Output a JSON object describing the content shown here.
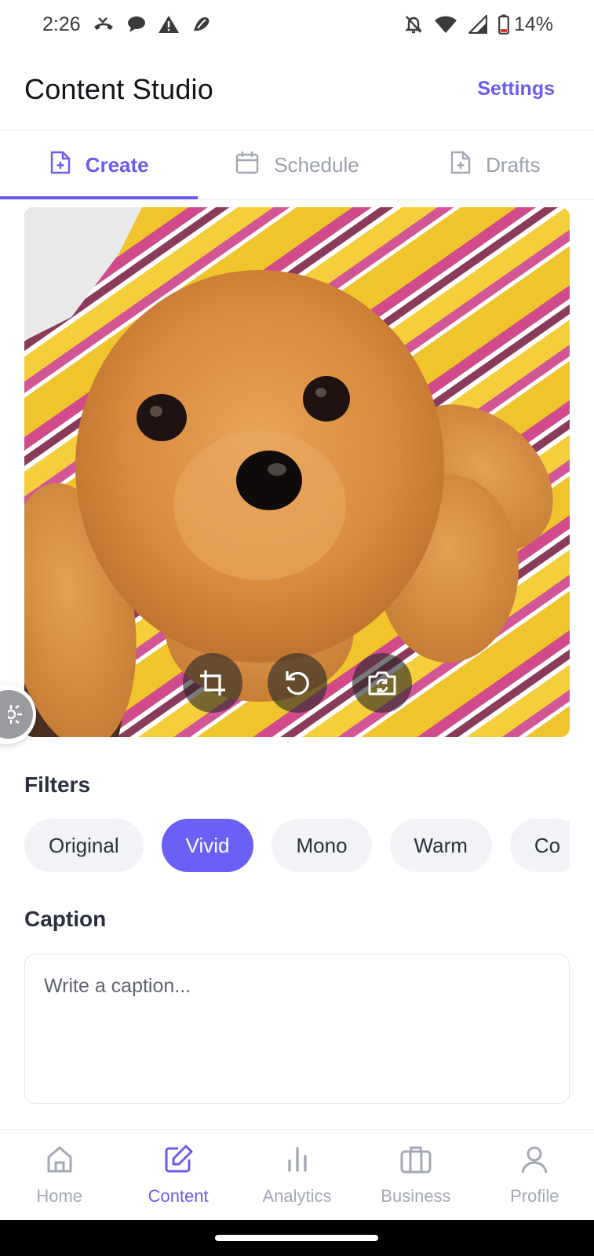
{
  "status_bar": {
    "time": "2:26",
    "battery": "14%",
    "icons": [
      "missed-call-icon",
      "chat-bubble-icon",
      "warning-icon",
      "app-logo-icon",
      "bell-off-icon",
      "wifi-icon",
      "signal-icon",
      "battery-icon"
    ]
  },
  "app_bar": {
    "title": "Content Studio",
    "settings_label": "Settings"
  },
  "tabs": [
    {
      "label": "Create",
      "icon": "file-plus-icon",
      "active": true
    },
    {
      "label": "Schedule",
      "icon": "calendar-icon",
      "active": false
    },
    {
      "label": "Drafts",
      "icon": "file-plus-icon",
      "active": false
    }
  ],
  "photo": {
    "subject": "",
    "tools": [
      "crop-icon",
      "rotate-icon",
      "switch-camera-icon"
    ]
  },
  "filters": {
    "title": "Filters",
    "items": [
      "Original",
      "Vivid",
      "Mono",
      "Warm",
      "Co"
    ],
    "selected": "Vivid"
  },
  "caption": {
    "title": "Caption",
    "placeholder": "Write a caption...",
    "value": ""
  },
  "bottom_nav": {
    "items": [
      {
        "label": "Home",
        "icon": "home-icon",
        "active": false
      },
      {
        "label": "Content",
        "icon": "edit-icon",
        "active": true
      },
      {
        "label": "Analytics",
        "icon": "bar-chart-icon",
        "active": false
      },
      {
        "label": "Business",
        "icon": "briefcase-icon",
        "active": false
      },
      {
        "label": "Profile",
        "icon": "user-icon",
        "active": false
      }
    ]
  },
  "colors": {
    "accent": "#6a5cf0",
    "chip_selected": "#6a60f5",
    "inactive": "#9aa0ad"
  }
}
